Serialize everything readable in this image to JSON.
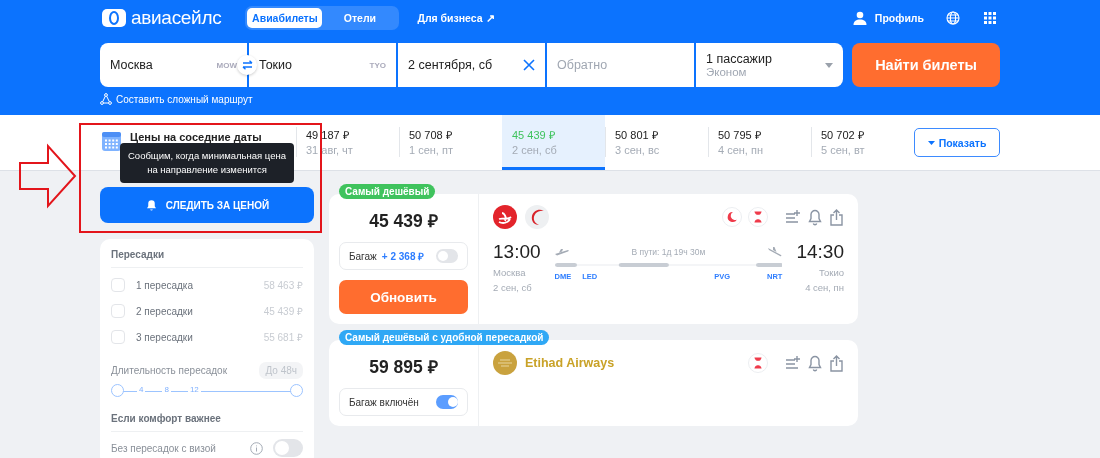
{
  "header": {
    "logo": "авиасейлс",
    "tabs": [
      {
        "label": "Авиабилеты",
        "selected": true
      },
      {
        "label": "Отели",
        "selected": false
      }
    ],
    "business_link": "Для бизнеса ↗",
    "profile": "Профиль"
  },
  "search": {
    "origin": {
      "value": "Москва",
      "code": "MOW"
    },
    "destination": {
      "value": "Токио",
      "code": "TYO"
    },
    "depart": {
      "value": "2 сентября, сб"
    },
    "return": {
      "placeholder": "Обратно"
    },
    "passengers": {
      "value": "1 пассажир",
      "class": "Эконом"
    },
    "submit": "Найти билеты",
    "complex_route": "Составить сложный маршрут"
  },
  "date_strip": {
    "label": "Цены на соседние даты",
    "dates": [
      {
        "price": "49 187 ₽",
        "date": "31 авг, чт",
        "selected": false
      },
      {
        "price": "50 708 ₽",
        "date": "1 сен, пт",
        "selected": false
      },
      {
        "price": "45 439 ₽",
        "date": "2 сен, сб",
        "selected": true
      },
      {
        "price": "50 801 ₽",
        "date": "3 сен, вс",
        "selected": false
      },
      {
        "price": "50 795 ₽",
        "date": "4 сен, пн",
        "selected": false
      },
      {
        "price": "50 702 ₽",
        "date": "5 сен, вт",
        "selected": false
      }
    ],
    "show_button": "Показать"
  },
  "price_alert": {
    "tooltip": "Сообщим, когда минимальная цена на направление изменится",
    "button": "СЛЕДИТЬ ЗА ЦЕНОЙ"
  },
  "filters": {
    "transfers": {
      "title": "Пересадки",
      "options": [
        {
          "label": "1 пересадка",
          "price": "58 463 ₽",
          "checked": false
        },
        {
          "label": "2 пересадки",
          "price": "45 439 ₽",
          "checked": false
        },
        {
          "label": "3 пересадки",
          "price": "55 681 ₽",
          "checked": false
        }
      ]
    },
    "duration": {
      "title": "Длительность пересадок",
      "value": "До 48ч",
      "ticks": [
        "4",
        "8",
        "12"
      ],
      "thumbs": [
        {
          "level": 0
        },
        {
          "level": 1
        }
      ]
    },
    "comfort": {
      "title": "Если комфорт важнее",
      "options": [
        {
          "label": "Без пересадок с визой",
          "on": false
        }
      ]
    }
  },
  "tickets": [
    {
      "badge": "Самый дешёвый",
      "color": "#3fc35d",
      "price": "45 439 ₽",
      "baggage": {
        "label": "Багаж",
        "extra": "+ 2 368 ₽",
        "on": false
      },
      "action": "Обновить",
      "airlines": [
        {
          "kind": "swirl"
        },
        {
          "kind": "crescent"
        }
      ],
      "flags": [
        {
          "kind": "night"
        },
        {
          "kind": "long_layover"
        }
      ],
      "flight": {
        "depart_time": "13:00",
        "depart_city": "Москва",
        "depart_date": "2 сен, сб",
        "duration": "В пути: 1д 19ч 30м",
        "arrive_time": "14:30",
        "arrive_city": "Токио",
        "arrive_date": "4 сен, пн",
        "airports": [
          "DME",
          "LED",
          "PVG",
          "NRT"
        ]
      }
    },
    {
      "badge": "Самый дешёвый с удобной пересадкой",
      "color": "#2fa8f5",
      "price": "59 895 ₽",
      "baggage": {
        "label": "Багаж включён",
        "on": true
      },
      "airlines": [
        {
          "kind": "emblem",
          "name": "Etihad Airways"
        }
      ],
      "flags": [
        {
          "kind": "long_layover"
        }
      ]
    }
  ]
}
